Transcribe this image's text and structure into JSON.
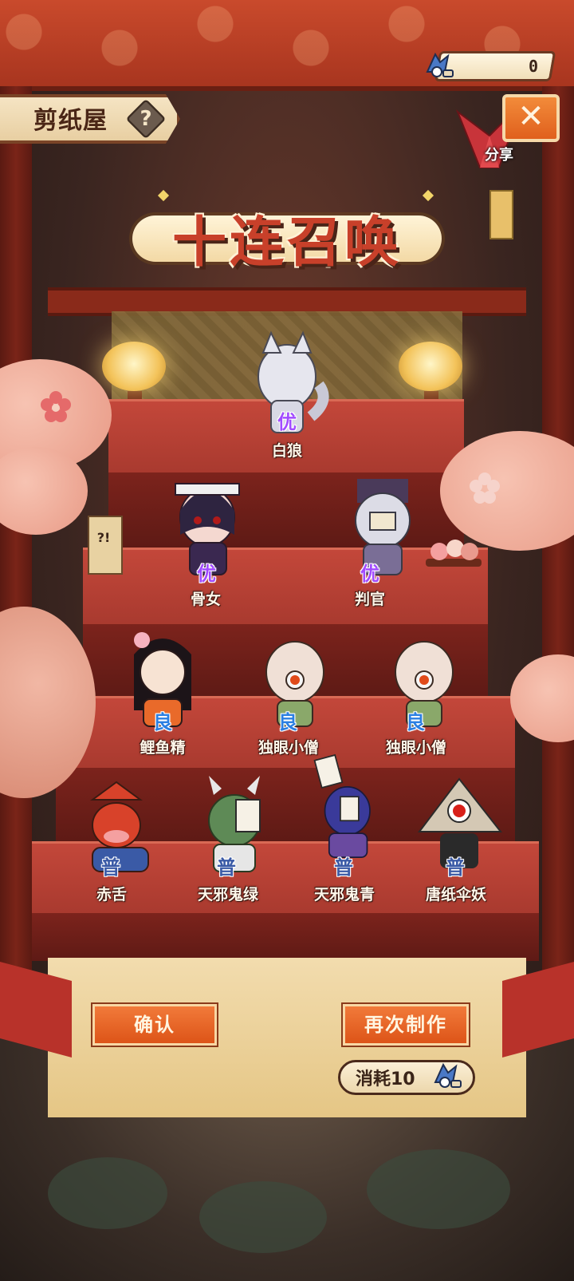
{
  "header": {
    "shop_title": "剪纸屋",
    "help_glyph": "?",
    "close_glyph": "✕",
    "share_label": "分享",
    "currency_value": "0",
    "currency_icon": "paper-fox-ticket-icon",
    "summon_title": "十连召唤"
  },
  "results": [
    {
      "name": "白狼",
      "rarity": "优"
    },
    {
      "name": "骨女",
      "rarity": "优"
    },
    {
      "name": "判官",
      "rarity": "优"
    },
    {
      "name": "鲤鱼精",
      "rarity": "良"
    },
    {
      "name": "独眼小僧",
      "rarity": "良"
    },
    {
      "name": "独眼小僧",
      "rarity": "良"
    },
    {
      "name": "赤舌",
      "rarity": "普"
    },
    {
      "name": "天邪鬼绿",
      "rarity": "普"
    },
    {
      "name": "天邪鬼青",
      "rarity": "普"
    },
    {
      "name": "唐纸伞妖",
      "rarity": "普"
    }
  ],
  "actions": {
    "confirm_label": "确认",
    "remake_label": "再次制作",
    "cost_label": "消耗10"
  },
  "colors": {
    "rarity_you": "#a24bff",
    "rarity_liang": "#2b7fe2",
    "rarity_pu": "#3a5aa6",
    "button": "#e3611f",
    "stair": "#b3402f"
  },
  "sign_text": "?!"
}
